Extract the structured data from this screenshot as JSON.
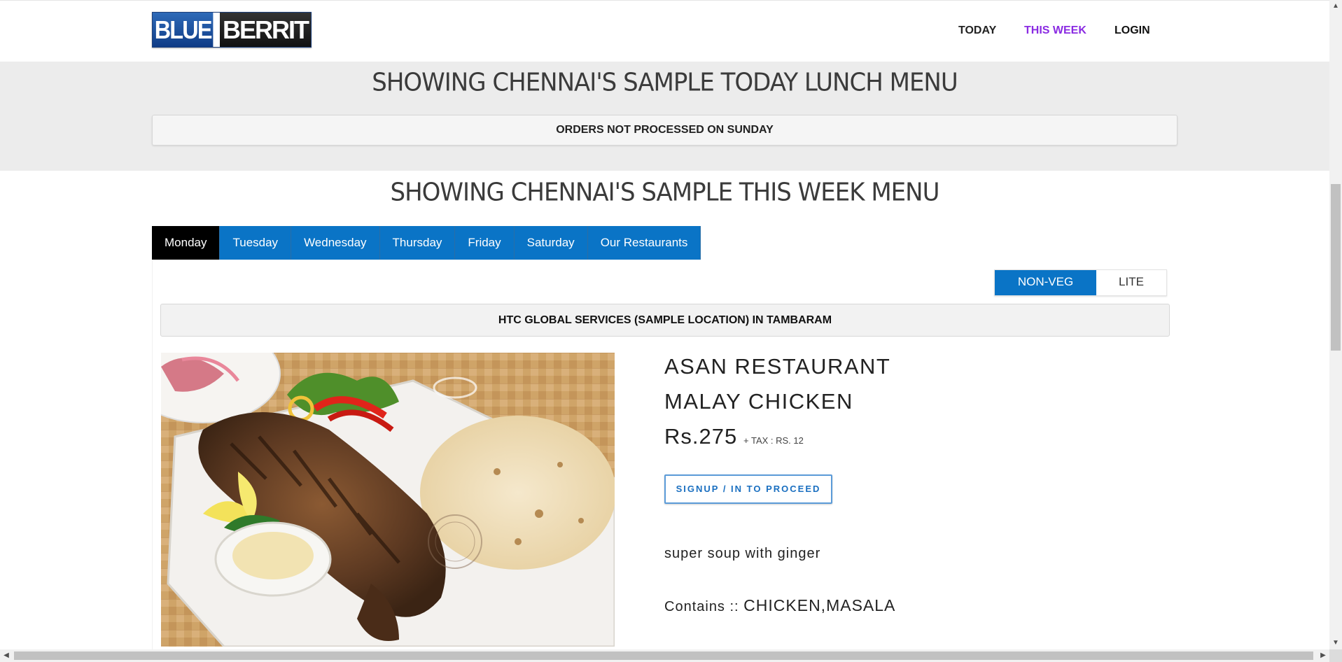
{
  "header": {
    "logo_part1": "BLUE",
    "logo_part2": "BERRIT",
    "nav": [
      {
        "label": "TODAY",
        "color": "#111111"
      },
      {
        "label": "THIS WEEK",
        "color": "#8a2be2"
      },
      {
        "label": "LOGIN",
        "color": "#111111"
      }
    ]
  },
  "today_section": {
    "title": "SHOWING CHENNAI'S SAMPLE TODAY LUNCH MENU",
    "notice": "ORDERS NOT PROCESSED ON SUNDAY"
  },
  "week_section": {
    "title": "SHOWING CHENNAI'S SAMPLE THIS WEEK MENU",
    "tabs": [
      "Monday",
      "Tuesday",
      "Wednesday",
      "Thursday",
      "Friday",
      "Saturday",
      "Our Restaurants"
    ],
    "active_tab": "Monday",
    "filter": {
      "on": "NON-VEG",
      "off": "LITE"
    },
    "location": "HTC GLOBAL SERVICES (SAMPLE LOCATION) IN TAMBARAM",
    "item": {
      "restaurant": "ASAN RESTAURANT",
      "dish": "MALAY CHICKEN",
      "price": "Rs.275",
      "tax": "+ TAX : RS. 12",
      "signup_button": "SIGNUP / IN TO PROCEED",
      "description": "super soup with ginger",
      "contains_label": "Contains ::",
      "contains_value": "CHICKEN,MASALA",
      "watermark": "ASAN RESTAURANT"
    }
  },
  "colors": {
    "accent_blue": "#0a74c6",
    "active_tab": "#000000",
    "band_grey": "#ececec",
    "this_week_nav": "#8a2be2"
  }
}
